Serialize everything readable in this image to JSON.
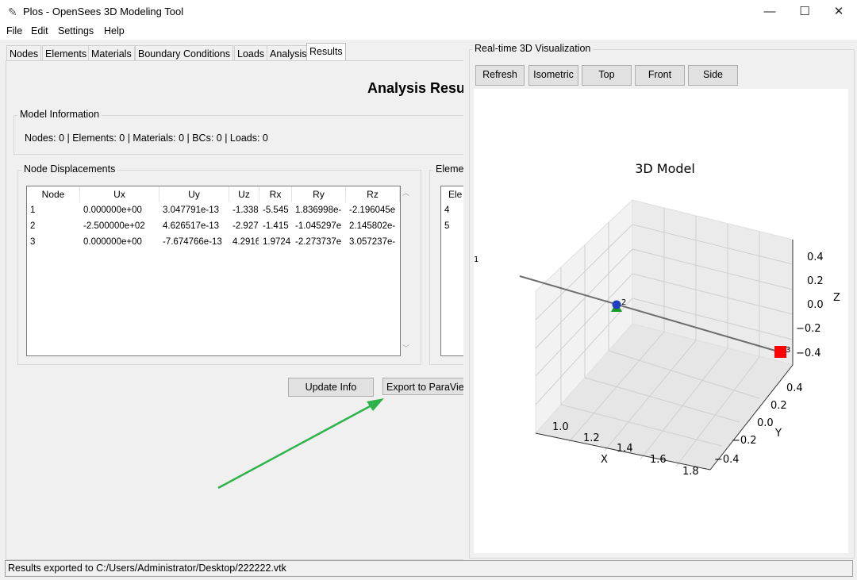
{
  "window": {
    "title": "Plos - OpenSees 3D Modeling Tool",
    "minimize": "—",
    "maximize": "☐",
    "close": "✕"
  },
  "menu": [
    "File",
    "Edit",
    "Settings",
    "Help"
  ],
  "tabs": [
    "Nodes",
    "Elements",
    "Materials",
    "Boundary Conditions",
    "Loads",
    "Analysis",
    "Results"
  ],
  "results": {
    "title": "Analysis Resu",
    "model_info_label": "Model Information",
    "model_info_text": "Nodes: 0 | Elements: 0 | Materials: 0 | BCs: 0 | Loads: 0",
    "node_disp_label": "Node Displacements",
    "columns": [
      "Node",
      "Ux",
      "Uy",
      "Uz",
      "Rx",
      "Ry",
      "Rz"
    ],
    "rows": [
      [
        "1",
        "0.000000e+00",
        "3.047791e-13",
        "-1.338",
        "-5.545",
        "1.836998e-",
        "-2.196045e"
      ],
      [
        "2",
        "-2.500000e+02",
        "4.626517e-13",
        "-2.927",
        "-1.415",
        "-1.045297e",
        "2.145802e-"
      ],
      [
        "3",
        "0.000000e+00",
        "-7.674766e-13",
        "4.2916",
        "1.9724",
        "-2.273737e",
        "3.057237e-"
      ]
    ],
    "elem_label": "Eleme",
    "elem_header": "Ele",
    "elem_rows": [
      "4",
      "5"
    ],
    "update_button": "Update Info",
    "export_button": "Export to ParaVie"
  },
  "viz": {
    "label": "Real-time 3D Visualization",
    "buttons": [
      "Refresh",
      "Isometric",
      "Top",
      "Front",
      "Side"
    ],
    "plot_title": "3D Model",
    "x_label": "X",
    "y_label": "Y",
    "z_label": "Z",
    "x_ticks": [
      "1.0",
      "1.2",
      "1.4",
      "1.6",
      "1.8"
    ],
    "y_ticks": [
      "0.4",
      "0.2",
      "0.0",
      "−0.2",
      "−0.4"
    ],
    "z_ticks": [
      "0.4",
      "0.2",
      "0.0",
      "−0.2",
      "−0.4"
    ],
    "node_labels": [
      "1",
      "2",
      "3"
    ],
    "colors": {
      "support_blue": "#1f3fbf",
      "support_green": "#1a9a2a",
      "load_red": "#ff0000",
      "arrow_green": "#2db34a"
    }
  },
  "status": "Results exported to C:/Users/Administrator/Desktop/222222.vtk"
}
